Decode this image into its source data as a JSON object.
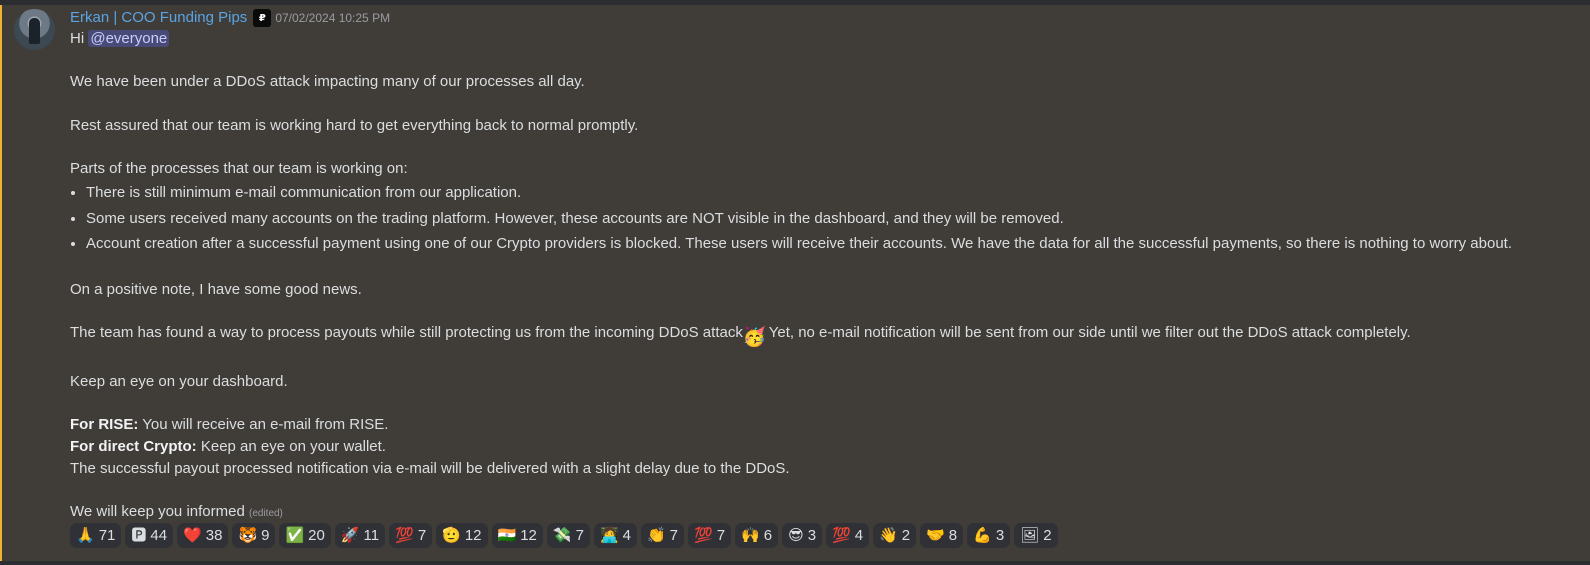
{
  "author": "Erkan | COO Funding Pips",
  "role_icon": "funding-pips-icon",
  "timestamp": "07/02/2024 10:25 PM",
  "greeting": "Hi",
  "mention": "@everyone",
  "lines": {
    "l1": "We have been under a DDoS attack impacting many of our processes all day.",
    "l2": "Rest assured that our team is working hard to get everything back to normal promptly.",
    "l3": "Parts of the processes that our team is working on:",
    "bullets": [
      "There is still minimum e-mail communication from our application.",
      "Some users received many accounts on the trading platform. However, these accounts are NOT visible in the dashboard, and they will be removed.",
      "Account creation after a successful payment using one of our Crypto providers is blocked. These users will receive their accounts. We have the data for all the successful payments, so there is nothing to worry about."
    ],
    "l4": "On a positive note, I have some good news.",
    "l5a": "The team has found a way to process payouts while still protecting us from the incoming DDoS attack",
    "l5_emoji": "🥳",
    "l5b": " Yet, no e-mail notification will be sent from our side until we filter out the DDoS attack completely.",
    "l6": "Keep an eye on your dashboard.",
    "rise_label": "For RISE:",
    "rise_text": " You will receive an e-mail from RISE.",
    "crypto_label": "For direct Crypto:",
    "crypto_text": " Keep an eye on your wallet.",
    "l7": "The successful payout processed notification via e-mail will be delivered with a slight delay due to the DDoS.",
    "l8": "We will keep you informed",
    "edited": "(edited)"
  },
  "reactions": [
    {
      "icon": "🙏",
      "count": "71"
    },
    {
      "icon": "🅿",
      "count": "44"
    },
    {
      "icon": "❤️",
      "count": "38"
    },
    {
      "icon": "🐯",
      "count": "9"
    },
    {
      "icon": "✅",
      "count": "20"
    },
    {
      "icon": "🚀",
      "count": "11"
    },
    {
      "icon": "💯",
      "count": "7"
    },
    {
      "icon": "🫡",
      "count": "12"
    },
    {
      "icon": "🇮🇳",
      "count": "12"
    },
    {
      "icon": "💸",
      "count": "7"
    },
    {
      "icon": "🧑‍💻",
      "count": "4"
    },
    {
      "icon": "👏",
      "count": "7"
    },
    {
      "icon": "💯",
      "count": "7"
    },
    {
      "icon": "🙌",
      "count": "6"
    },
    {
      "icon": "😎",
      "count": "3"
    },
    {
      "icon": "💯",
      "count": "4"
    },
    {
      "icon": "👋",
      "count": "2"
    },
    {
      "icon": "🤝",
      "count": "8"
    },
    {
      "icon": "💪",
      "count": "3"
    },
    {
      "icon": "🖼",
      "count": "2"
    }
  ]
}
